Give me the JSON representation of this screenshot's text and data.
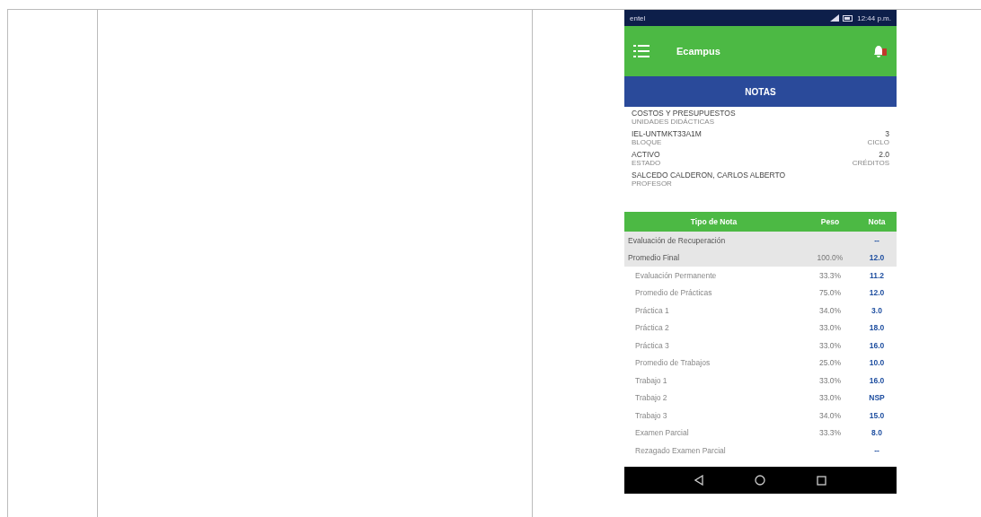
{
  "phone": {
    "status_bar": {
      "carrier": "entel",
      "time": "12:44 p.m."
    },
    "app_bar": {
      "title": "Ecampus"
    },
    "section_title": "NOTAS",
    "info": [
      {
        "value": "COSTOS Y PRESUPUESTOS",
        "label": "UNIDADES DIDÁCTICAS"
      },
      {
        "value": "IEL-UNTMKT33A1M",
        "label": "BLOQUE",
        "side_value": "3",
        "side_label": "CICLO"
      },
      {
        "value": "ACTIVO",
        "label": "ESTADO",
        "side_value": "2.0",
        "side_label": "CRÉDITOS"
      },
      {
        "value": "SALCEDO CALDERON, CARLOS ALBERTO",
        "label": "PROFESOR"
      }
    ],
    "table": {
      "columns": [
        "Tipo de Nota",
        "Peso",
        "Nota"
      ],
      "rows": [
        {
          "type": "Evaluación de Recuperación",
          "grade": "--"
        },
        {
          "type": "Promedio Final",
          "weight": "100.0%",
          "grade": "12.0",
          "children": [
            {
              "type": "Evaluación Permanente",
              "weight": "33.3%",
              "grade": "11.2"
            },
            {
              "type": "Promedio de Prácticas",
              "weight": "75.0%",
              "grade": "12.0"
            },
            {
              "type": "Práctica 1",
              "weight": "34.0%",
              "grade": "3.0"
            },
            {
              "type": "Práctica 2",
              "weight": "33.0%",
              "grade": "18.0"
            },
            {
              "type": "Práctica 3",
              "weight": "33.0%",
              "grade": "16.0"
            },
            {
              "type": "Promedio de Trabajos",
              "weight": "25.0%",
              "grade": "10.0"
            },
            {
              "type": "Trabajo 1",
              "weight": "33.0%",
              "grade": "16.0"
            },
            {
              "type": "Trabajo 2",
              "weight": "33.0%",
              "grade": "NSP"
            },
            {
              "type": "Trabajo 3",
              "weight": "34.0%",
              "grade": "15.0"
            },
            {
              "type": "Examen Parcial",
              "weight": "33.3%",
              "grade": "8.0"
            },
            {
              "type": "Rezagado Examen Parcial",
              "grade": "--"
            }
          ]
        }
      ]
    }
  }
}
